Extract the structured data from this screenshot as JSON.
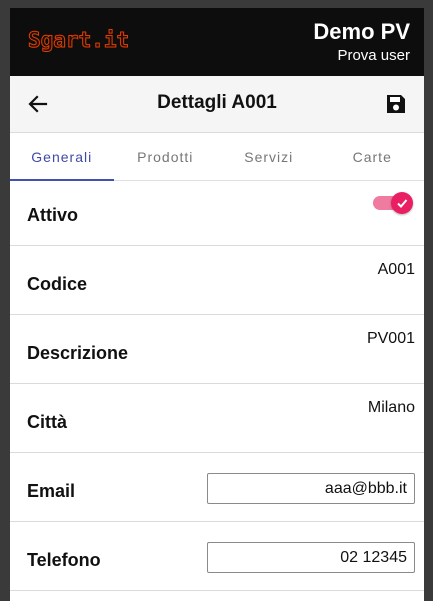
{
  "app": {
    "logo_text": "Sgart.it",
    "user_name": "Demo PV",
    "user_role": "Prova user"
  },
  "header": {
    "title": "Dettagli A001",
    "back_icon": "arrow-left-icon",
    "save_icon": "floppy-disk-icon"
  },
  "tabs": [
    {
      "label": "Generali",
      "active": true
    },
    {
      "label": "Prodotti",
      "active": false
    },
    {
      "label": "Servizi",
      "active": false
    },
    {
      "label": "Carte",
      "active": false
    }
  ],
  "fields": {
    "attivo": {
      "label": "Attivo",
      "checked": true
    },
    "codice": {
      "label": "Codice",
      "value": "A001"
    },
    "descrizione": {
      "label": "Descrizione",
      "value": "PV001"
    },
    "citta": {
      "label": "Città",
      "value": "Milano"
    },
    "email": {
      "label": "Email",
      "value": "aaa@bbb.it"
    },
    "telefono": {
      "label": "Telefono",
      "value": "02 12345"
    }
  },
  "colors": {
    "tab_active": "#3f51b5",
    "toggle_on": "#e91e63",
    "topbar": "#0d0d0d"
  }
}
